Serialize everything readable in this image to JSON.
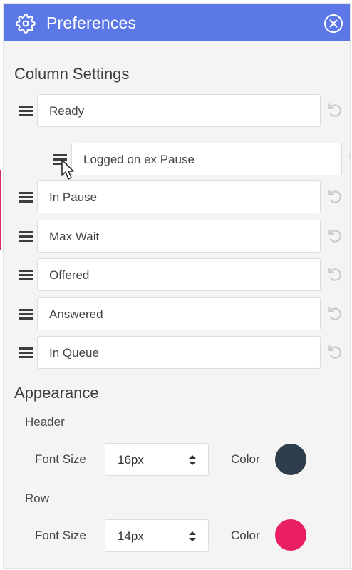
{
  "header": {
    "title": "Preferences",
    "gear_icon": "gear-icon",
    "close_icon": "close-circle-icon",
    "color": "#5b78e6"
  },
  "column_settings": {
    "title": "Column Settings",
    "items": [
      {
        "label": "Ready"
      },
      {
        "label": "Logged on ex Pause",
        "dragging": true
      },
      {
        "label": "In Pause"
      },
      {
        "label": "Max Wait"
      },
      {
        "label": "Offered"
      },
      {
        "label": "Answered"
      },
      {
        "label": "In Queue"
      }
    ]
  },
  "appearance": {
    "title": "Appearance",
    "header": {
      "title": "Header",
      "font_size_label": "Font Size",
      "font_size": "16px",
      "color_label": "Color",
      "color": "#2f3e4d"
    },
    "row": {
      "title": "Row",
      "font_size_label": "Font Size",
      "font_size": "14px",
      "color_label": "Color",
      "color": "#e91e63"
    }
  }
}
